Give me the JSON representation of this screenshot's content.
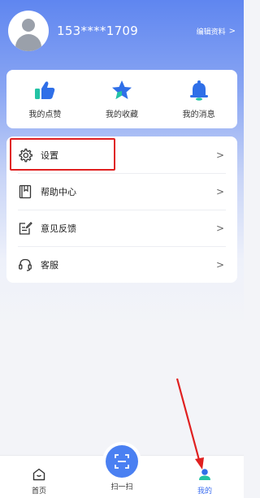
{
  "profile": {
    "phone": "153****1709",
    "edit_label": "编辑资料",
    "edit_chevron": ">"
  },
  "quick_actions": [
    {
      "label": "我的点赞",
      "icon": "thumbs-up-icon"
    },
    {
      "label": "我的收藏",
      "icon": "star-icon"
    },
    {
      "label": "我的消息",
      "icon": "bell-icon"
    }
  ],
  "menu": [
    {
      "label": "设置",
      "icon": "gear-icon",
      "chevron": ">"
    },
    {
      "label": "帮助中心",
      "icon": "help-book-icon",
      "chevron": ">"
    },
    {
      "label": "意见反馈",
      "icon": "feedback-edit-icon",
      "chevron": ">"
    },
    {
      "label": "客服",
      "icon": "headset-icon",
      "chevron": ">"
    }
  ],
  "tabbar": {
    "home": "首页",
    "scan": "扫一扫",
    "mine": "我的"
  },
  "colors": {
    "accent": "#3c6ef0",
    "highlight": "#e02020",
    "header_gradient_top": "#5f86f0"
  }
}
